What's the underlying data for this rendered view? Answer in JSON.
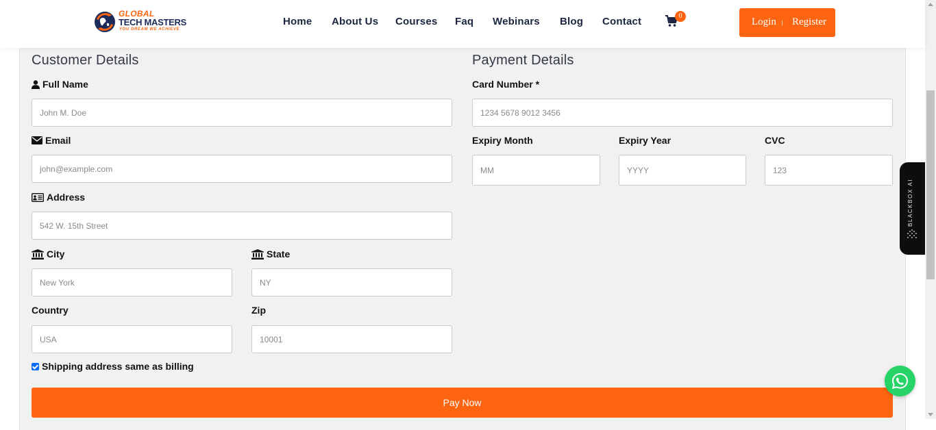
{
  "brand": {
    "line1": "GLOBAL",
    "line2": "TECH MASTERS",
    "tagline": "YOU DREAM WE ACHIEVE",
    "accent_color": "#ff6410",
    "navy_color": "#1c2b5a"
  },
  "nav": {
    "items": [
      "Home",
      "About Us",
      "Courses",
      "Faq",
      "Webinars",
      "Blog",
      "Contact"
    ],
    "cart_count": "0",
    "login_label": "Login",
    "register_label": "Register"
  },
  "customer": {
    "title": "Customer Details",
    "full_name": {
      "label": "Full Name",
      "placeholder": "John M. Doe",
      "icon": "user-icon"
    },
    "email": {
      "label": "Email",
      "placeholder": "john@example.com",
      "icon": "envelope-icon"
    },
    "address": {
      "label": "Address",
      "placeholder": "542 W. 15th Street",
      "icon": "address-card-icon"
    },
    "city": {
      "label": "City",
      "placeholder": "New York",
      "icon": "institution-icon"
    },
    "state": {
      "label": "State",
      "placeholder": "NY",
      "icon": "institution-icon"
    },
    "country": {
      "label": "Country",
      "placeholder": "USA"
    },
    "zip": {
      "label": "Zip",
      "placeholder": "10001"
    },
    "shipping_same": {
      "label": "Shipping address same as billing",
      "checked": true
    }
  },
  "payment": {
    "title": "Payment Details",
    "card_number": {
      "label": "Card Number *",
      "placeholder": "1234 5678 9012 3456"
    },
    "expiry_month": {
      "label": "Expiry Month",
      "placeholder": "MM"
    },
    "expiry_year": {
      "label": "Expiry Year",
      "placeholder": "YYYY"
    },
    "cvc": {
      "label": "CVC",
      "placeholder": "123"
    }
  },
  "pay_button": "Pay Now",
  "blackbox": {
    "label": "BLACKBOX AI"
  },
  "whatsapp": {
    "icon": "whatsapp-icon",
    "color": "#25d366"
  }
}
